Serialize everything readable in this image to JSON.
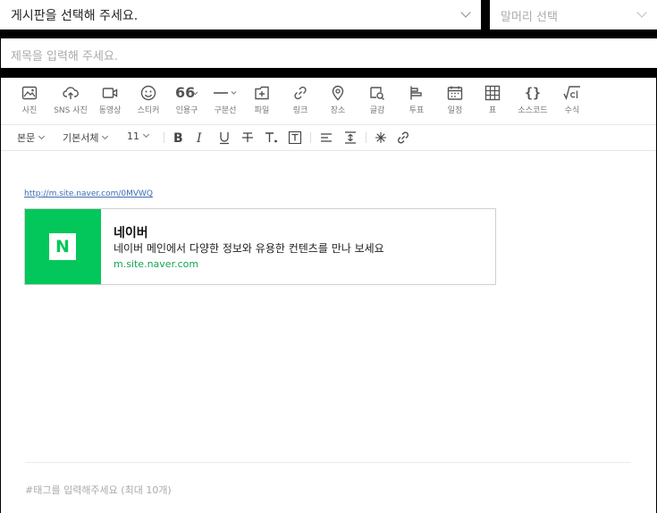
{
  "board_select": {
    "text": "게시판을 선택해 주세요."
  },
  "head_select": {
    "text": "말머리 선택"
  },
  "title": {
    "placeholder": "제목을 입력해 주세요."
  },
  "toolbar": {
    "items": [
      {
        "label": "사진",
        "icon": "photo-icon"
      },
      {
        "label": "SNS 사진",
        "icon": "cloud-upload-icon"
      },
      {
        "label": "동영상",
        "icon": "video-icon"
      },
      {
        "label": "스티커",
        "icon": "smile-icon"
      },
      {
        "label": "인용구",
        "icon": "quote-icon"
      },
      {
        "label": "구분선",
        "icon": "divider-icon"
      },
      {
        "label": "파일",
        "icon": "file-icon"
      },
      {
        "label": "링크",
        "icon": "link-icon"
      },
      {
        "label": "장소",
        "icon": "location-icon"
      },
      {
        "label": "글감",
        "icon": "search-doc-icon"
      },
      {
        "label": "투표",
        "icon": "vote-icon"
      },
      {
        "label": "일정",
        "icon": "calendar-icon"
      },
      {
        "label": "표",
        "icon": "table-icon"
      },
      {
        "label": "소스코드",
        "icon": "code-icon"
      },
      {
        "label": "수식",
        "icon": "formula-icon"
      }
    ]
  },
  "format_bar": {
    "paragraph": "본문",
    "font": "기본서체",
    "size": "11"
  },
  "content": {
    "link_url": "http://m.site.naver.com/0MVWQ",
    "og_card": {
      "logo_letter": "N",
      "title": "네이버",
      "description": "네이버 메인에서 다양한 정보와 유용한 컨텐츠를 만나 보세요",
      "domain": "m.site.naver.com",
      "brand_color": "#03c75a"
    }
  },
  "tags": {
    "placeholder": "#태그를 입력해주세요 (최대 10개)"
  }
}
